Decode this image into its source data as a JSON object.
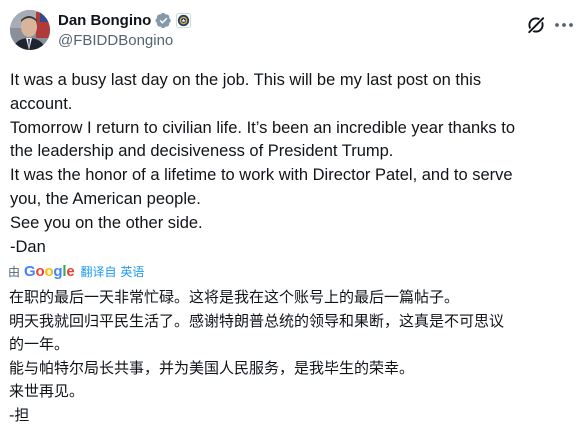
{
  "author": {
    "display_name": "Dan Bongino",
    "handle": "@FBIDDBongino",
    "verified_badge_icon": "verified-badge-icon",
    "affiliation_icon": "fbi-seal-icon"
  },
  "actions": {
    "grok_icon": "grok-icon",
    "more_icon": "more-options-icon"
  },
  "post": {
    "lines": [
      "It was a busy last day on the job. This will be my last post on this",
      "account.",
      "Tomorrow I return to civilian life. It’s been an incredible year thanks to",
      "the leadership and decisiveness of President Trump.",
      "It was the honor of a lifetime to work with Director Patel, and to serve",
      "you, the American people.",
      "See you on the other side.",
      "-Dan"
    ]
  },
  "translation": {
    "by_label": "由",
    "provider": "Google",
    "link_label": "翻译自 英语",
    "lines": [
      "在职的最后一天非常忙碌。这将是我在这个账号上的最后一篇帖子。",
      "明天我就回归平民生活了。感谢特朗普总统的领导和果断，这真是不可思议",
      "的一年。",
      "能与帕特尔局长共事，并为美国人民服务，是我毕生的荣幸。",
      "来世再见。",
      "-担"
    ]
  },
  "colors": {
    "text": "#0f1419",
    "secondary": "#536471",
    "link": "#1d9bf0",
    "verified": "#1d9bf0"
  }
}
